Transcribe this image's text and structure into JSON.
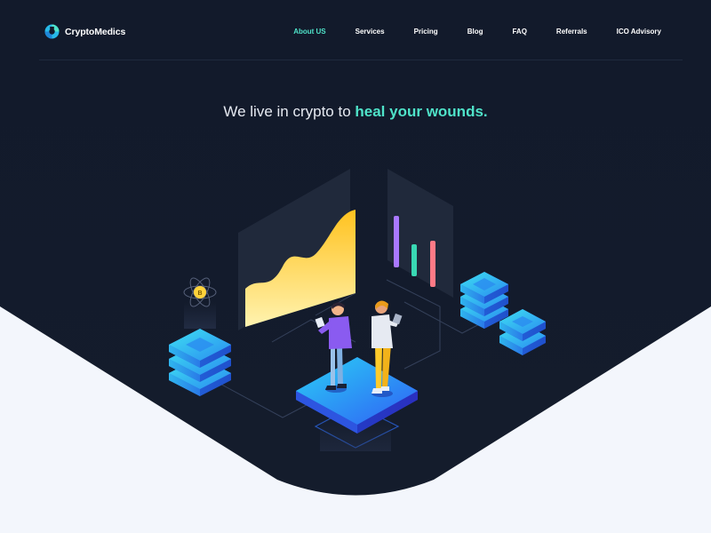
{
  "brand": {
    "name": "CryptoMedics",
    "logo_icon": "crypto-medics-logo-icon",
    "accent": "#4fe3c9"
  },
  "nav": {
    "items": [
      {
        "label": "About US",
        "active": true
      },
      {
        "label": "Services"
      },
      {
        "label": "Pricing"
      },
      {
        "label": "Blog"
      },
      {
        "label": "FAQ"
      },
      {
        "label": "Referrals"
      },
      {
        "label": "ICO Advisory"
      }
    ]
  },
  "hero": {
    "title_prefix": "We live in crypto to ",
    "title_highlight": "heal your wounds."
  },
  "illustration": {
    "coin_symbol": "B"
  },
  "colors": {
    "background_dark": "#121a2a",
    "background_light": "#f3f6fc",
    "platform_blue": "#2d6df6",
    "server_cyan": "#33c6f0",
    "chart_yellow": "#ffcf3a"
  }
}
